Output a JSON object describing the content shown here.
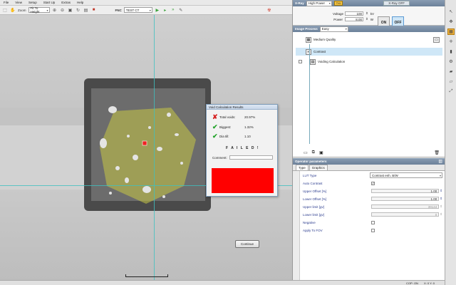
{
  "menu": [
    "File",
    "View",
    "Setup",
    "Start Up",
    "Extras",
    "Help"
  ],
  "toolbar": {
    "zoom_label": "Zoom",
    "zoom_value": "Fit To Height",
    "fnc_label": "FNC",
    "fnc_value": "TEST CT"
  },
  "dialog": {
    "title": "Void Calculation Results",
    "rows": [
      {
        "icon": "✘",
        "color": "#d62020",
        "key": "Total voids:",
        "value": "20.97%"
      },
      {
        "icon": "✔",
        "color": "#22a32a",
        "key": "Biggest:",
        "value": "1.32%"
      },
      {
        "icon": "✔",
        "color": "#22a32a",
        "key": "Dia till:",
        "value": "1.10"
      }
    ],
    "status": "F A I L E D !",
    "comment_label": "Comment:",
    "continue_label": "Continue",
    "panel_color": "#ff0000"
  },
  "xray": {
    "header": "X-Ray",
    "mode": "High Power",
    "state_badge": "X-Ray OFF",
    "voltage_label": "Voltage",
    "voltage_value": "100",
    "voltage_unit": "kV",
    "power_label": "Power",
    "power_value": "8.00",
    "power_unit": "W",
    "on_label": "ON",
    "off_label": "OFF"
  },
  "image_process": {
    "header": "Image Process",
    "mode": "Easy",
    "items": [
      {
        "label": "Medium Quality",
        "selected": false
      },
      {
        "label": "Contrast",
        "selected": true
      },
      {
        "label": "Voiding Calculation",
        "selected": false
      }
    ]
  },
  "operator": {
    "header": "Operator parameters",
    "tabs": [
      "Type",
      "Graphics"
    ],
    "params": [
      {
        "label": "LUT Type",
        "kind": "select",
        "value": "Contrast enh. B/W"
      },
      {
        "label": "Auto Contrast",
        "kind": "check",
        "value": "✓"
      },
      {
        "label": "Upper Offset [%]",
        "kind": "num",
        "value": "1.00"
      },
      {
        "label": "Lower Offset [%]",
        "kind": "num",
        "value": "1.00"
      },
      {
        "label": "Upper limit   [gv]",
        "kind": "num",
        "value": "39144"
      },
      {
        "label": "Lower limit   [gv]",
        "kind": "num",
        "value": "0"
      },
      {
        "label": "Negative",
        "kind": "check",
        "value": ""
      },
      {
        "label": "Apply To FOV",
        "kind": "check",
        "value": ""
      }
    ]
  },
  "status": {
    "cop": "COP: ON",
    "coords": "X: 0  Y: 0"
  },
  "colors": {
    "accent": "#5b9bd5",
    "header": "#7a8ea6",
    "fail": "#ff0000",
    "cursor": "#3fc0c0"
  }
}
